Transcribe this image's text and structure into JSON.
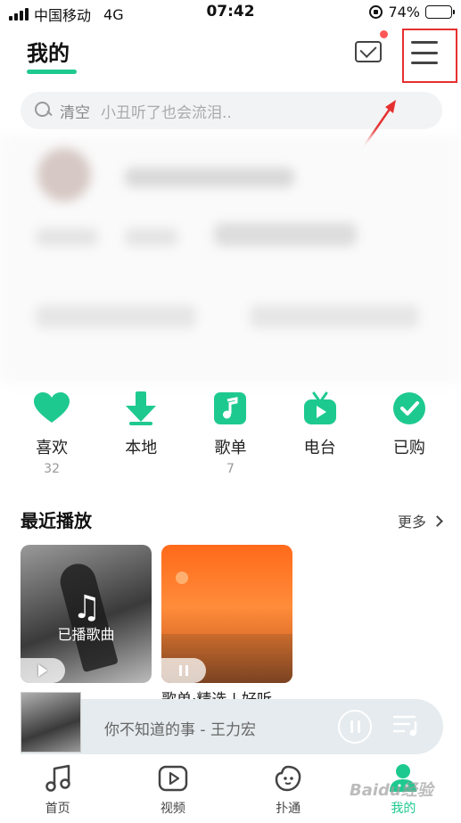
{
  "status_bar": {
    "carrier": "中国移动",
    "network": "4G",
    "time": "07:42",
    "battery_percent": "74%",
    "battery_level": 0.74
  },
  "header": {
    "title": "我的",
    "mail_icon": "envelope-icon",
    "menu_icon": "hamburger-menu-icon",
    "accent_color": "#1ec98f",
    "badge_color": "#ff5757",
    "highlight_color": "#e63030"
  },
  "search": {
    "clear_label": "清空",
    "hint": "小丑听了也会流泪.."
  },
  "quick_actions": [
    {
      "label": "喜欢",
      "count": "32",
      "icon": "heart-icon"
    },
    {
      "label": "本地",
      "count": "",
      "icon": "download-icon"
    },
    {
      "label": "歌单",
      "count": "7",
      "icon": "music-note-icon"
    },
    {
      "label": "电台",
      "count": "",
      "icon": "radio-tv-icon"
    },
    {
      "label": "已购",
      "count": "",
      "icon": "check-circle-icon"
    }
  ],
  "recent": {
    "title": "最近播放",
    "more_label": "更多",
    "card1_label": "已播歌曲",
    "card2_caption": "歌单·精选 | 好听"
  },
  "mini_player": {
    "track": "你不知道的事 - 王力宏"
  },
  "tabs": [
    {
      "label": "首页",
      "icon": "music-note-outline-icon"
    },
    {
      "label": "视频",
      "icon": "video-play-icon"
    },
    {
      "label": "扑通",
      "icon": "face-blob-icon"
    },
    {
      "label": "我的",
      "icon": "profile-icon"
    }
  ],
  "watermark": "Baidu经验"
}
